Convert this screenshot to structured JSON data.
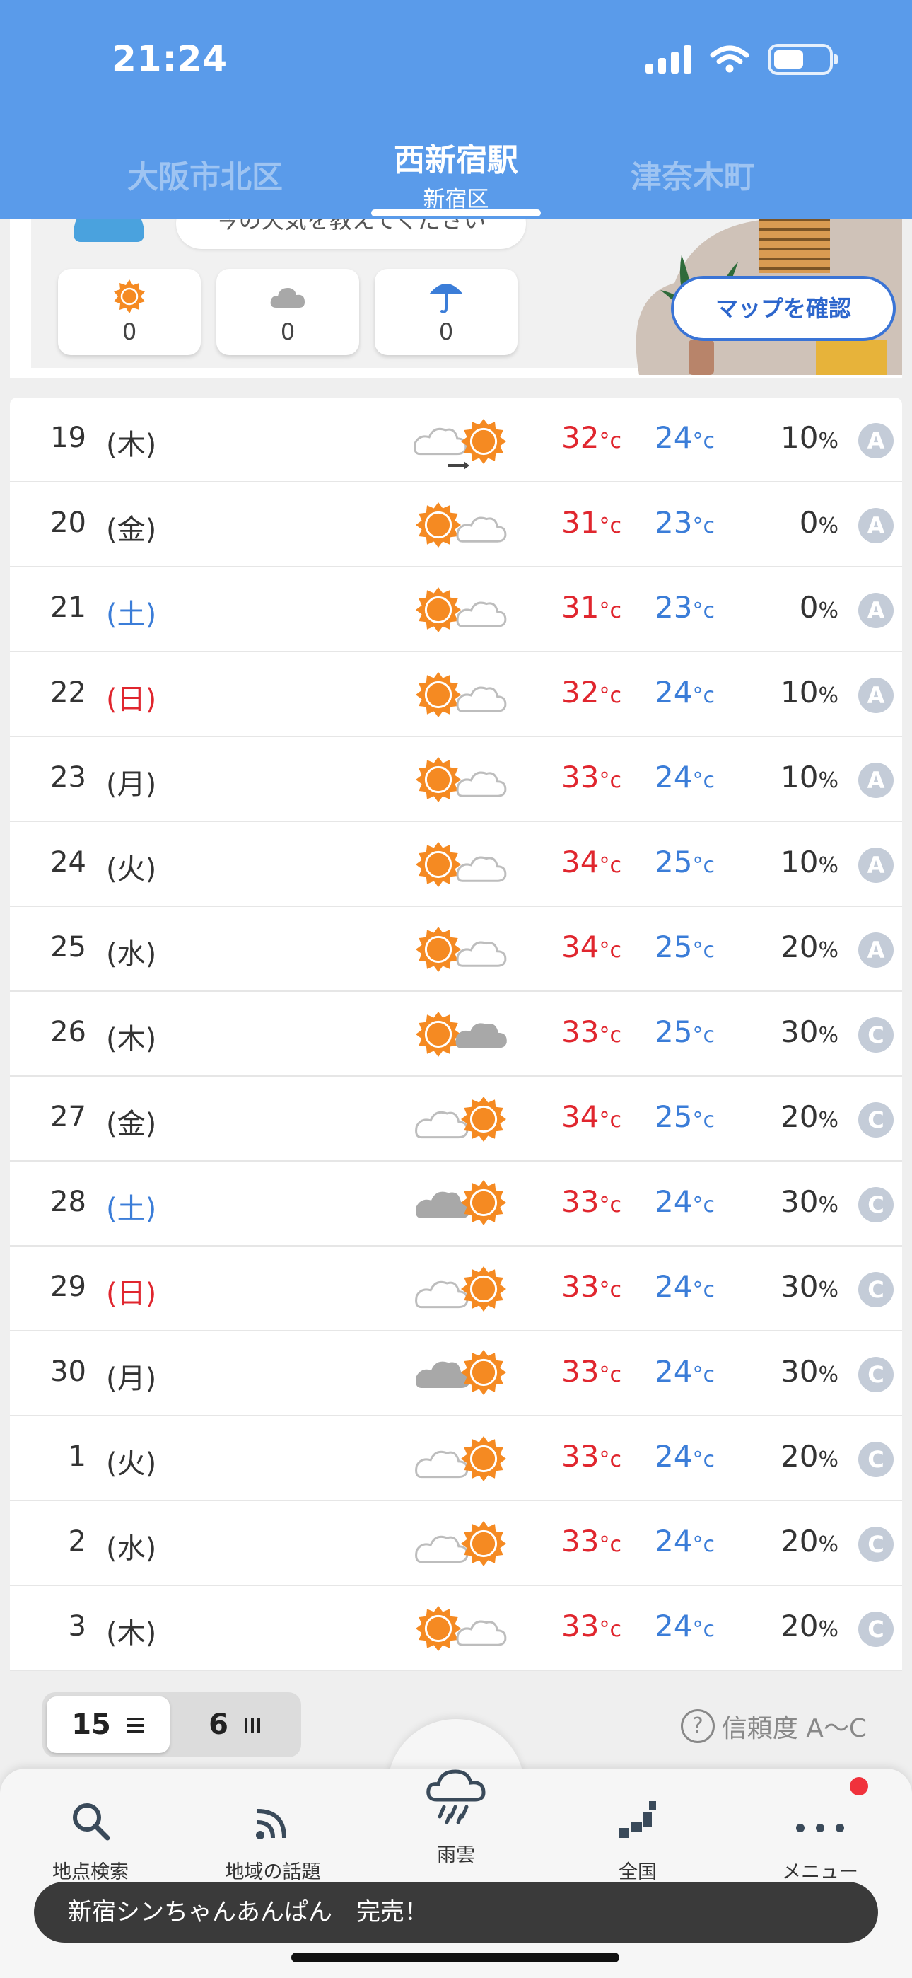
{
  "status_bar": {
    "time": "21:24"
  },
  "location_tabs": {
    "prev": "大阪市北区",
    "current": {
      "name": "西新宿駅",
      "area": "新宿区"
    },
    "next": "津奈木町"
  },
  "survey": {
    "question": "今の天気を教えてください",
    "votes": [
      {
        "icon": "sun-icon",
        "count": "0"
      },
      {
        "icon": "cloud-icon",
        "count": "0"
      },
      {
        "icon": "umbrella-icon",
        "count": "0"
      }
    ],
    "map_button": "マップを確認"
  },
  "forecast": {
    "temp_unit": "°c",
    "pop_unit": "%",
    "rows": [
      {
        "day": "19",
        "weekday": "(木)",
        "weekday_type": "weekday",
        "weather": "cloudy-then-sunny",
        "high": "32",
        "low": "24",
        "pop": "10",
        "reliability": "A"
      },
      {
        "day": "20",
        "weekday": "(金)",
        "weekday_type": "weekday",
        "weather": "sunny-sometimes-cloudy",
        "high": "31",
        "low": "23",
        "pop": "0",
        "reliability": "A"
      },
      {
        "day": "21",
        "weekday": "(土)",
        "weekday_type": "sat",
        "weather": "sunny-sometimes-cloudy",
        "high": "31",
        "low": "23",
        "pop": "0",
        "reliability": "A"
      },
      {
        "day": "22",
        "weekday": "(日)",
        "weekday_type": "sun",
        "weather": "sunny-sometimes-cloudy",
        "high": "32",
        "low": "24",
        "pop": "10",
        "reliability": "A"
      },
      {
        "day": "23",
        "weekday": "(月)",
        "weekday_type": "weekday",
        "weather": "sunny-sometimes-cloudy",
        "high": "33",
        "low": "24",
        "pop": "10",
        "reliability": "A"
      },
      {
        "day": "24",
        "weekday": "(火)",
        "weekday_type": "weekday",
        "weather": "sunny-sometimes-cloudy",
        "high": "34",
        "low": "25",
        "pop": "10",
        "reliability": "A"
      },
      {
        "day": "25",
        "weekday": "(水)",
        "weekday_type": "weekday",
        "weather": "sunny-sometimes-cloudy",
        "high": "34",
        "low": "25",
        "pop": "20",
        "reliability": "A"
      },
      {
        "day": "26",
        "weekday": "(木)",
        "weekday_type": "weekday",
        "weather": "sunny-sometimes-darkcloud",
        "high": "33",
        "low": "25",
        "pop": "30",
        "reliability": "C"
      },
      {
        "day": "27",
        "weekday": "(金)",
        "weekday_type": "weekday",
        "weather": "cloudy-sometimes-sunny",
        "high": "34",
        "low": "25",
        "pop": "20",
        "reliability": "C"
      },
      {
        "day": "28",
        "weekday": "(土)",
        "weekday_type": "sat",
        "weather": "darkcloud-sometimes-sunny",
        "high": "33",
        "low": "24",
        "pop": "30",
        "reliability": "C"
      },
      {
        "day": "29",
        "weekday": "(日)",
        "weekday_type": "sun",
        "weather": "cloudy-sometimes-sunny",
        "high": "33",
        "low": "24",
        "pop": "30",
        "reliability": "C"
      },
      {
        "day": "30",
        "weekday": "(月)",
        "weekday_type": "weekday",
        "weather": "darkcloud-sometimes-sunny",
        "high": "33",
        "low": "24",
        "pop": "30",
        "reliability": "C"
      },
      {
        "day": "1",
        "weekday": "(火)",
        "weekday_type": "weekday",
        "weather": "cloudy-sometimes-sunny",
        "high": "33",
        "low": "24",
        "pop": "20",
        "reliability": "C"
      },
      {
        "day": "2",
        "weekday": "(水)",
        "weekday_type": "weekday",
        "weather": "cloudy-sometimes-sunny",
        "high": "33",
        "low": "24",
        "pop": "20",
        "reliability": "C"
      },
      {
        "day": "3",
        "weekday": "(木)",
        "weekday_type": "weekday",
        "weather": "sunny-sometimes-cloudy",
        "high": "33",
        "low": "24",
        "pop": "20",
        "reliability": "C"
      }
    ]
  },
  "controls": {
    "view_15": "15",
    "view_6": "6",
    "reliability_label": "信頼度 A〜C",
    "help_glyph": "?"
  },
  "tabbar": {
    "search": "地点検索",
    "topics": "地域の話題",
    "rain": "雨雲",
    "national": "全国",
    "menu": "メニュー"
  },
  "toast": "新宿シンちゃんあんぱん　完売！",
  "colors": {
    "header_blue": "#5a9bea",
    "high_red": "#e0262e",
    "low_blue": "#3b7dd8",
    "sun_orange": "#f58a22",
    "cloud_gray": "#cfcfcf",
    "darkcloud_gray": "#a8a8a8"
  }
}
